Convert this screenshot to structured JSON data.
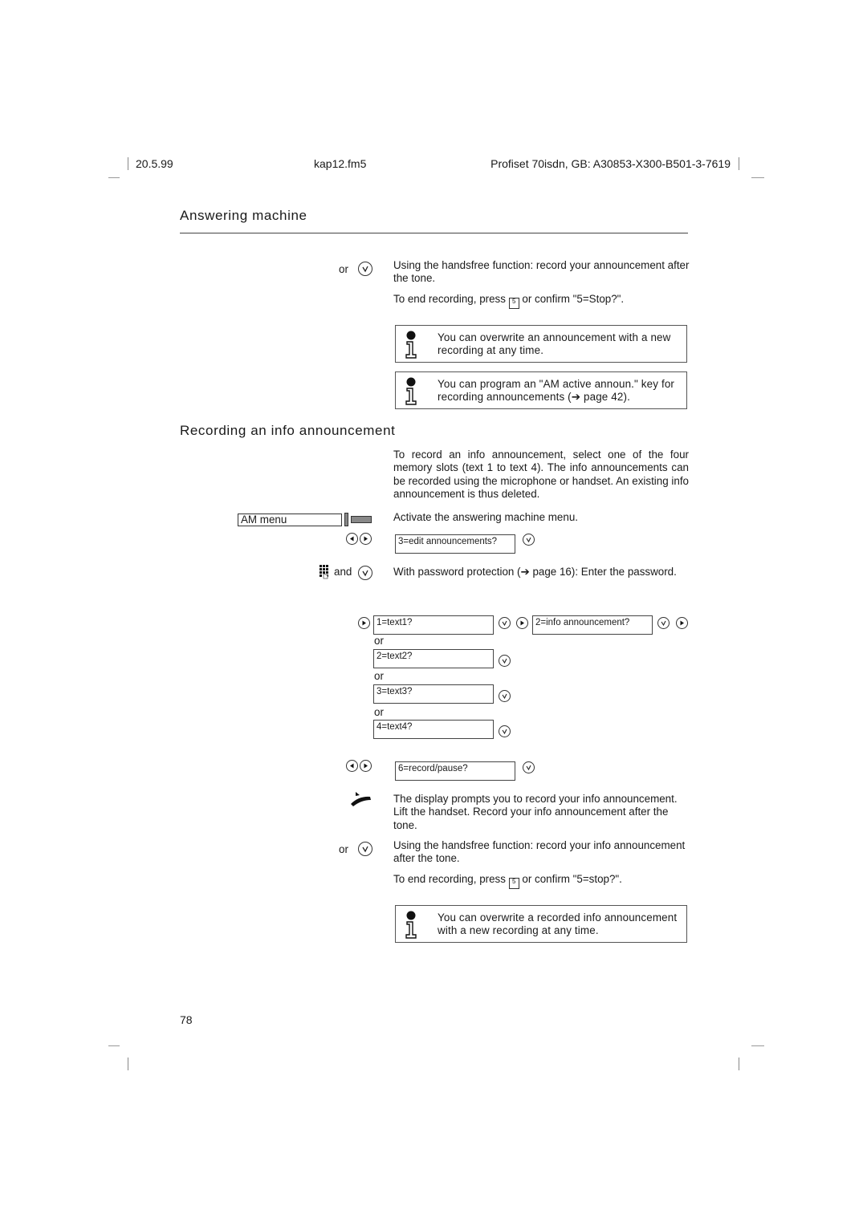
{
  "header": {
    "date": "20.5.99",
    "file": "kap12.fm5",
    "product": "Profiset 70isdn, GB: A30853-X300-B501-3-7619"
  },
  "section1": {
    "title": "Answering machine",
    "or_label": "or",
    "handsfree_text": "Using the handsfree function: record your announcement after the tone.",
    "end_recording_prefix": "To end recording, press",
    "end_recording_suffix": "or confirm \"5=Stop?\".",
    "notes": [
      "You can overwrite an announcement with a new recording at any time.",
      "You can program an \"AM active announ.\" key for recording announcements (➔ page 42)."
    ]
  },
  "section2": {
    "title": "Recording an info announcement",
    "intro": "To record an info announcement, select one of the four memory slots (text 1 to text 4). The info announcements can be recorded using the microphone or handset. An existing info announcement is thus deleted.",
    "am_menu_label": "AM menu",
    "activate_text": "Activate the answering machine menu.",
    "display_edit": "3=edit announcements?",
    "and_label": "and",
    "password_text": "With password protection (➔ page 16): Enter the password.",
    "text_options": [
      "1=text1?",
      "2=text2?",
      "3=text3?",
      "4=text4?"
    ],
    "or_label": "or",
    "display_info": "2=info announcement?",
    "display_record": "6=record/pause?",
    "handset_text": "The display prompts you to record your info announcement. Lift the handset. Record your info announcement after the tone.",
    "handsfree_text": "Using the handsfree function: record your info announcement after the tone.",
    "end_recording_prefix": "To end recording, press",
    "end_recording_suffix": "or confirm \"5=stop?\".",
    "note": "You can overwrite a recorded info announcement with a new recording at any time."
  },
  "key_label": "5",
  "footer": {
    "page_number": "78"
  }
}
